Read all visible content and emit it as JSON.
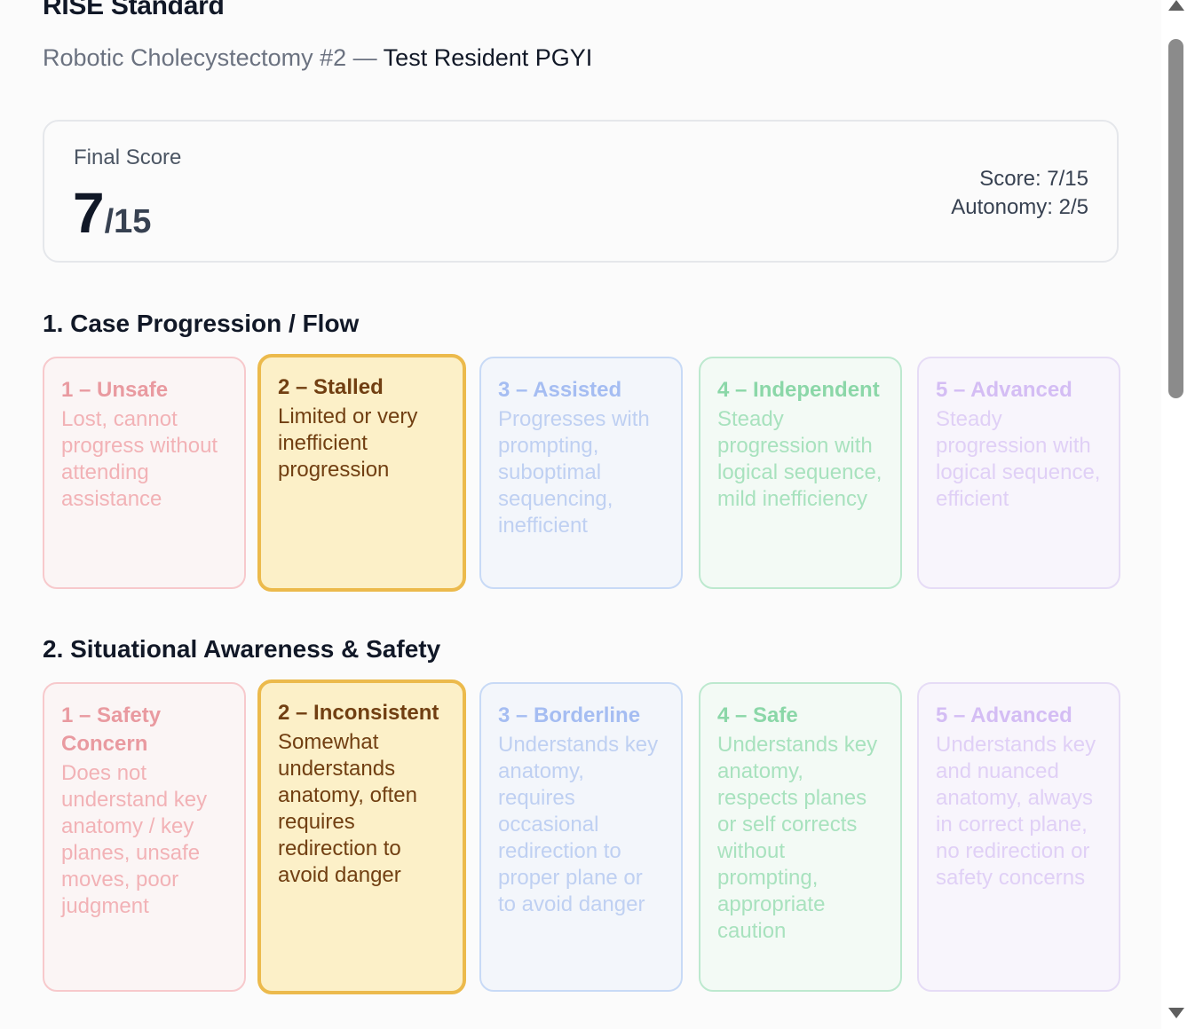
{
  "header": {
    "title": "RISE Standard",
    "procedure": "Robotic Cholecystectomy #2",
    "separator": " — ",
    "resident": "Test Resident PGYI"
  },
  "score": {
    "label": "Final Score",
    "value": "7",
    "total": "/15",
    "score_line": "Score: 7/15",
    "autonomy_line": "Autonomy: 2/5"
  },
  "sections": [
    {
      "heading": "1. Case Progression / Flow",
      "selected_level": 2,
      "options": [
        {
          "title": "1 – Unsafe",
          "desc": "Lost, cannot progress without attending assistance"
        },
        {
          "title": "2 – Stalled",
          "desc": "Limited or very inefficient progression"
        },
        {
          "title": "3 – Assisted",
          "desc": "Progresses with prompting, suboptimal sequencing, inefficient"
        },
        {
          "title": "4 – Independent",
          "desc": "Steady progression with logical sequence, mild inefficiency"
        },
        {
          "title": "5 – Advanced",
          "desc": "Steady progression with logical sequence, efficient"
        }
      ]
    },
    {
      "heading": "2. Situational Awareness & Safety",
      "selected_level": 2,
      "options": [
        {
          "title": "1 – Safety Concern",
          "desc": "Does not understand key anatomy / key planes, unsafe moves, poor judgment"
        },
        {
          "title": "2 – Inconsistent",
          "desc": "Somewhat understands anatomy, often requires redirection to avoid danger"
        },
        {
          "title": "3 – Borderline",
          "desc": "Understands key anatomy, requires occasional redirection to proper plane or to avoid danger"
        },
        {
          "title": "4 – Safe",
          "desc": "Understands key anatomy, respects planes or self corrects without prompting, appropriate caution"
        },
        {
          "title": "5 – Advanced",
          "desc": "Understands key and nuanced anatomy, always in correct plane, no redirection or safety concerns"
        }
      ]
    }
  ]
}
